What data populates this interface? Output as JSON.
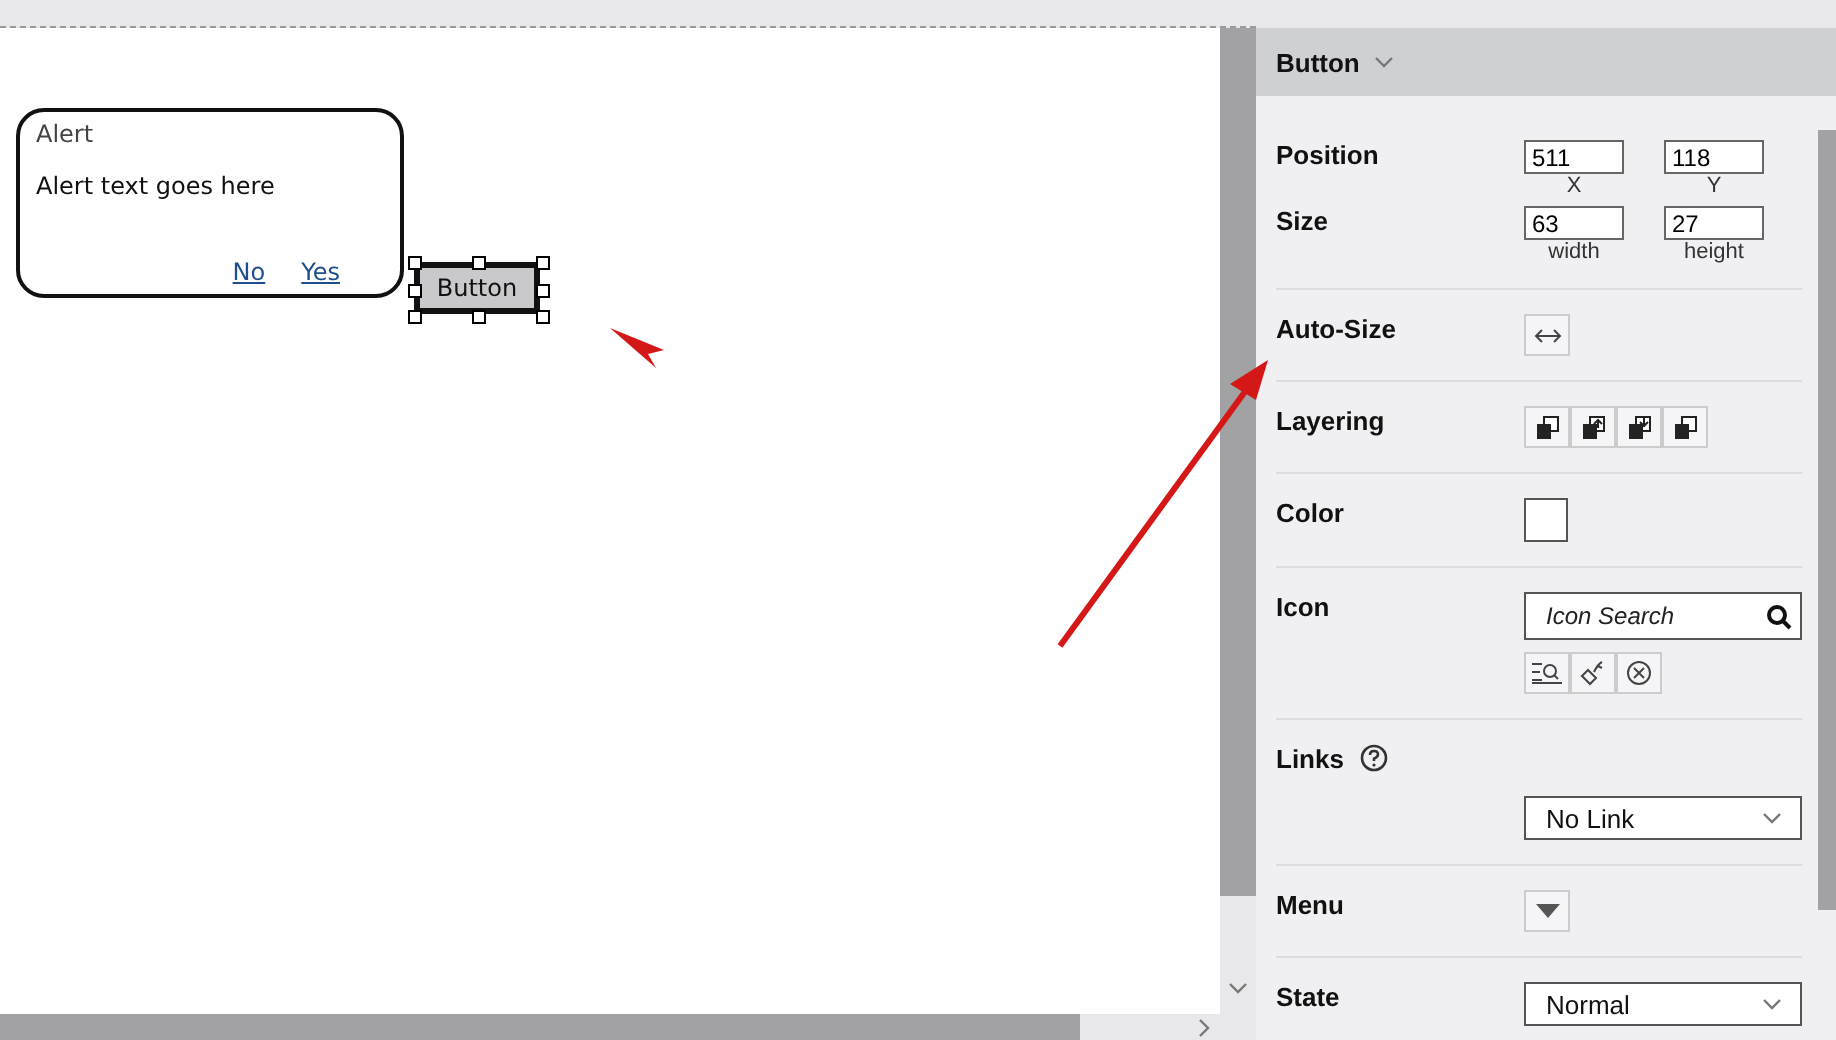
{
  "canvas": {
    "alert": {
      "title": "Alert",
      "text": "Alert text goes here",
      "buttons": [
        "No",
        "Yes"
      ]
    },
    "button": {
      "label": "Button",
      "selected": true
    }
  },
  "inspector": {
    "title": "Button",
    "rows": [
      {
        "kind": "pair",
        "label": "Position",
        "fields": [
          {
            "value": "511",
            "caption": "X"
          },
          {
            "value": "118",
            "caption": "Y"
          }
        ]
      },
      {
        "kind": "pair",
        "label": "Size",
        "fields": [
          {
            "value": "63",
            "caption": "width"
          },
          {
            "value": "27",
            "caption": "height"
          }
        ]
      },
      {
        "kind": "autosize",
        "label": "Auto-Size"
      },
      {
        "kind": "layering",
        "label": "Layering"
      },
      {
        "kind": "color",
        "label": "Color",
        "color": "#ffffff"
      },
      {
        "kind": "icon",
        "label": "Icon",
        "placeholder": "Icon Search"
      },
      {
        "kind": "links",
        "label": "Links",
        "value": "No Link"
      },
      {
        "kind": "menu",
        "label": "Menu"
      },
      {
        "kind": "select",
        "label": "State",
        "value": "Normal"
      }
    ]
  }
}
